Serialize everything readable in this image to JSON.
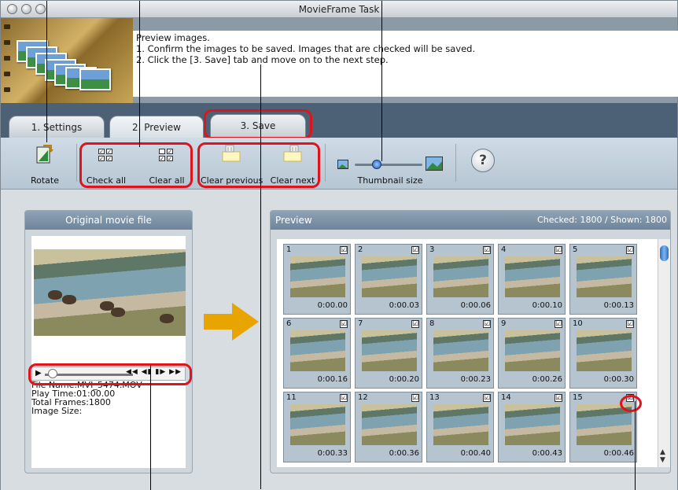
{
  "window": {
    "title": "MovieFrame Task"
  },
  "instructions": {
    "lines": [
      "Preview images.",
      "1. Confirm the images to be saved. Images that are checked will be saved.",
      "2. Click the [3. Save] tab and move on to the next step."
    ]
  },
  "tabs": [
    {
      "label": "1. Settings"
    },
    {
      "label": "2. Preview"
    },
    {
      "label": "3. Save"
    }
  ],
  "toolbar": {
    "rotate": "Rotate",
    "check_all": "Check all",
    "clear_all": "Clear all",
    "clear_previous": "Clear previous",
    "clear_next": "Clear next",
    "thumbnail_size": "Thumbnail size",
    "help": "?",
    "thumbnail_size_level": 0.3
  },
  "original": {
    "title": "Original movie file",
    "file_name": "File Name:MVI_5474.MOV",
    "play_time": "Play Time:01:00.00",
    "total_frames": "Total Frames:1800",
    "image_size": "Image Size:"
  },
  "preview": {
    "title": "Preview",
    "status": "Checked: 1800 / Shown: 1800",
    "thumbs": [
      {
        "n": "1",
        "t": "0:00.00"
      },
      {
        "n": "2",
        "t": "0:00.03"
      },
      {
        "n": "3",
        "t": "0:00.06"
      },
      {
        "n": "4",
        "t": "0:00.10"
      },
      {
        "n": "5",
        "t": "0:00.13"
      },
      {
        "n": "6",
        "t": "0:00.16"
      },
      {
        "n": "7",
        "t": "0:00.20"
      },
      {
        "n": "8",
        "t": "0:00.23"
      },
      {
        "n": "9",
        "t": "0:00.26"
      },
      {
        "n": "10",
        "t": "0:00.30"
      },
      {
        "n": "11",
        "t": "0:00.33"
      },
      {
        "n": "12",
        "t": "0:00.36"
      },
      {
        "n": "13",
        "t": "0:00.40"
      },
      {
        "n": "14",
        "t": "0:00.43"
      },
      {
        "n": "15",
        "t": "0:00.46"
      }
    ],
    "checkmark": "☑"
  },
  "colors": {
    "accent": "#e0121b",
    "tabbar": "#4d6176",
    "arrow": "#e8a400"
  }
}
